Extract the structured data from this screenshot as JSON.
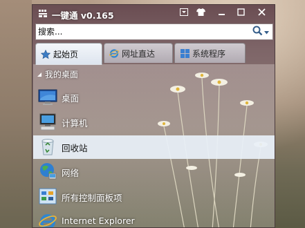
{
  "window": {
    "title": "一键通 v0.165"
  },
  "search": {
    "placeholder": "搜索..."
  },
  "tabs": [
    {
      "label": "起始页",
      "icon": "star-icon",
      "active": true
    },
    {
      "label": "网址直达",
      "icon": "ie-icon",
      "active": false
    },
    {
      "label": "系统程序",
      "icon": "windows-icon",
      "active": false
    }
  ],
  "section": {
    "label": "我的桌面"
  },
  "items": [
    {
      "label": "桌面",
      "icon": "desktop-icon"
    },
    {
      "label": "计算机",
      "icon": "computer-icon"
    },
    {
      "label": "回收站",
      "icon": "recycle-bin-icon",
      "selected": true
    },
    {
      "label": "网络",
      "icon": "network-icon"
    },
    {
      "label": "所有控制面板项",
      "icon": "control-panel-icon"
    },
    {
      "label": "Internet Explorer",
      "icon": "ie-icon"
    }
  ],
  "colors": {
    "accent": "#2f5f9a",
    "selected_row": "#e8f0f8"
  }
}
